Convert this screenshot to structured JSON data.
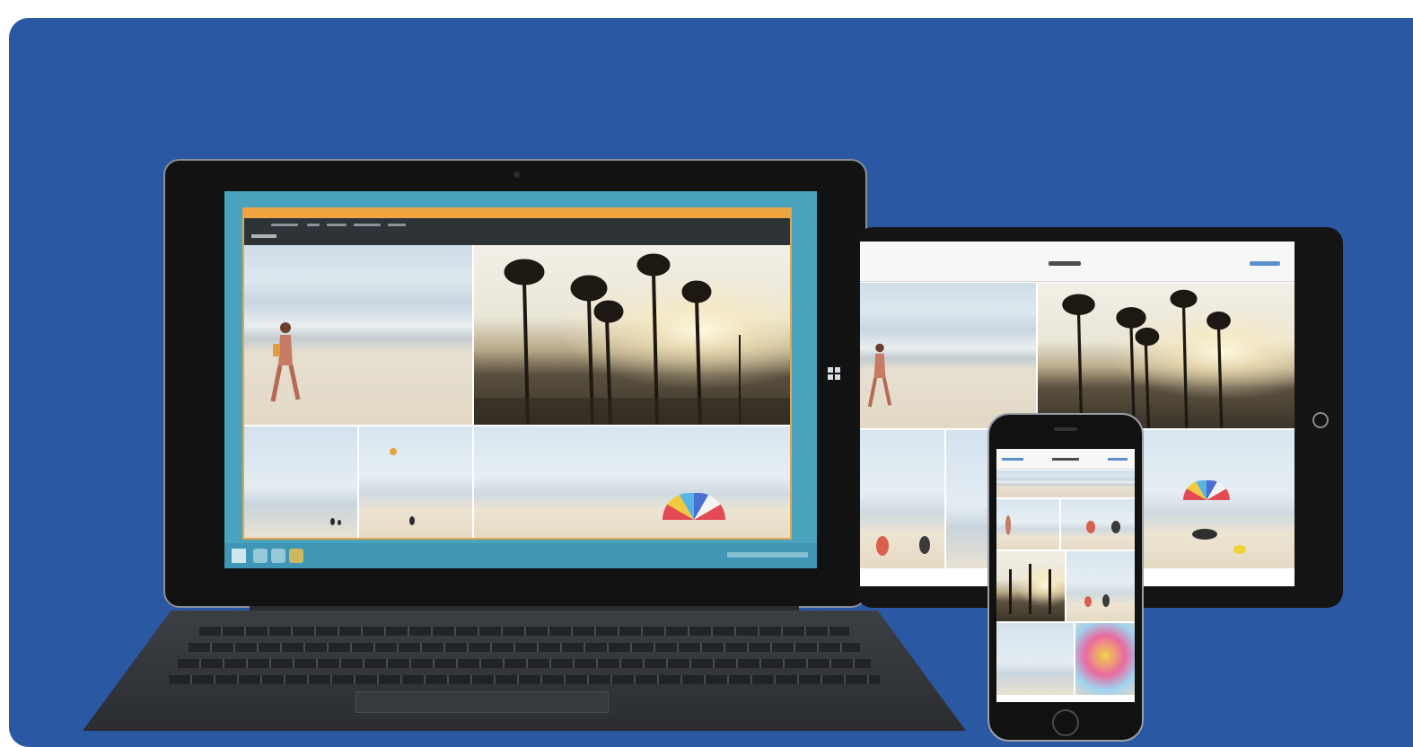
{
  "scene": {
    "background_color": "#2a58a3",
    "devices": [
      "laptop",
      "tablet",
      "phone"
    ],
    "laptop_accent": "#4aa3bd",
    "app_window_accent": "#f0a640"
  },
  "icons": {
    "laptop_windows_button": "windows-logo-icon",
    "tablet_home_button": "home-button-icon",
    "phone_home_button": "home-button-icon"
  }
}
